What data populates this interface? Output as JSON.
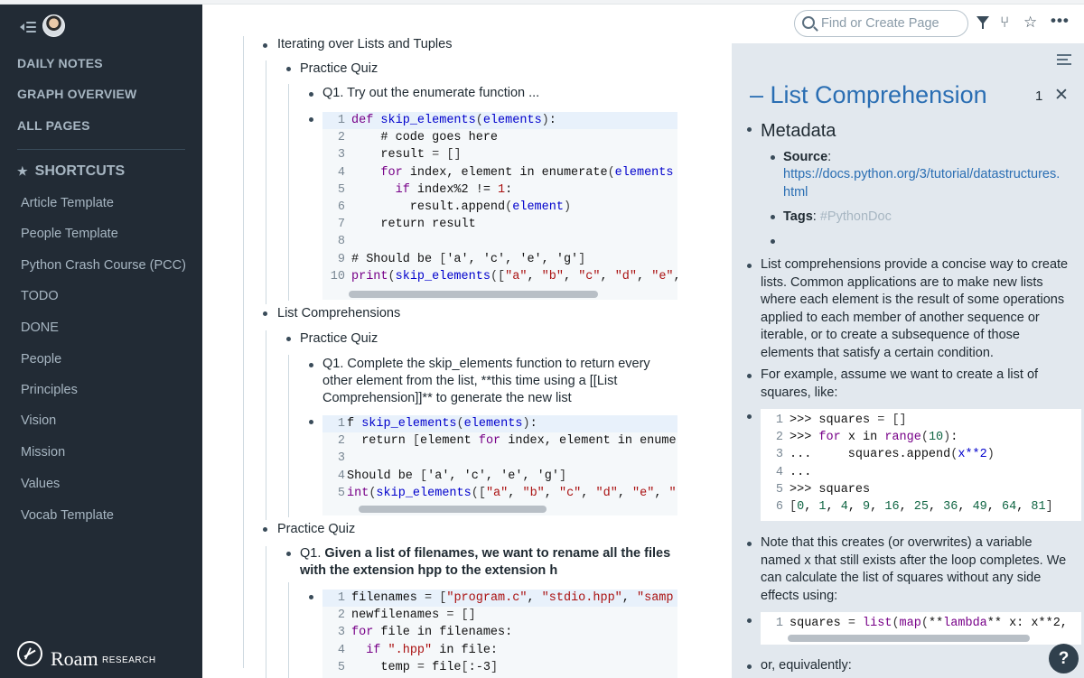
{
  "sidebar": {
    "nav": [
      "DAILY NOTES",
      "GRAPH OVERVIEW",
      "ALL PAGES"
    ],
    "shortcuts_title": "SHORTCUTS",
    "shortcuts": [
      "Article Template",
      "People Template",
      "Python Crash Course (PCC)",
      "TODO",
      "DONE",
      "People",
      "Principles",
      "Vision",
      "Mission",
      "Values",
      "Vocab Template"
    ],
    "brand_word": "Roam",
    "brand_sub": "RESEARCH"
  },
  "topbar": {
    "search_placeholder": "Find or Create Page"
  },
  "main": {
    "iterating": "Iterating over Lists and Tuples",
    "practice_quiz": "Practice Quiz",
    "q1a": "Q1. Try out the enumerate function ...",
    "list_comprehensions": "List Comprehensions",
    "q1b_line1": "Q1. Complete the skip_elements function to return every",
    "q1b_line2": "other element from the list, **this time using a [[List",
    "q1b_line3": "Comprehension]]** to generate the new list",
    "q1c_prefix": "Q1. ",
    "q1c_line1": "Given a list of filenames, we want to rename all the files",
    "q1c_line2": "with the extension hpp to the extension h"
  },
  "code1": [
    "1",
    "2",
    "3",
    "4",
    "5",
    "6",
    "7",
    "8",
    "9",
    "10"
  ],
  "code2": [
    "1",
    "2",
    "3",
    "4",
    "5"
  ],
  "code3": [
    "1",
    "2",
    "3",
    "4",
    "5"
  ],
  "panel": {
    "title": "List Comprehension",
    "count": "1",
    "metadata": "Metadata",
    "source_label": "Source",
    "source_url_1": "https://docs.python.org/3/tutorial/datastructures.",
    "source_url_2": "html",
    "tags_label": "Tags",
    "tags_value": "#PythonDoc",
    "para1": [
      "List comprehensions provide a concise way to create",
      "lists. Common applications are to make new lists",
      "where each element is the result of some operations",
      "applied to each member of another sequence or",
      "iterable, or to create a subsequence of those",
      "elements that satisfy a certain condition."
    ],
    "para2": [
      "For example, assume we want to create a list of",
      "squares, like:"
    ],
    "para3": [
      "Note that this creates (or overwrites) a variable",
      "named x that still exists after the loop completes. We",
      "can calculate the list of squares without any side",
      "effects using:"
    ],
    "para4": "or, equivalently:",
    "pcode1": [
      "1",
      "2",
      "3",
      "4",
      "5",
      "6"
    ],
    "pcode2": [
      "1"
    ]
  },
  "help_label": "?"
}
